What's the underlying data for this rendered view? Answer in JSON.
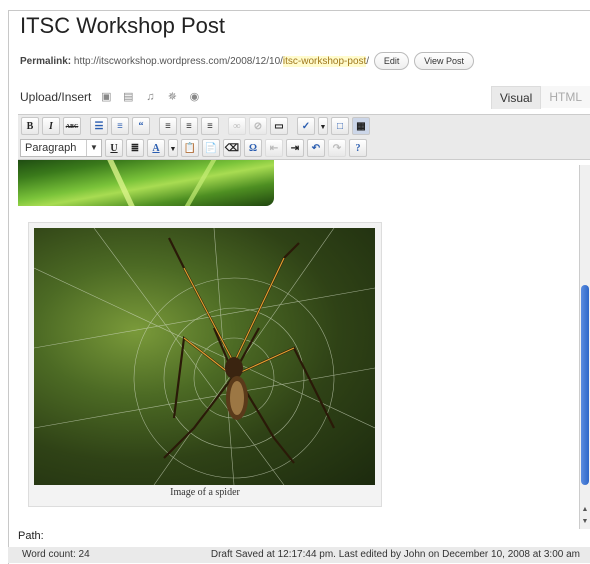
{
  "post": {
    "title": "ITSC Workshop Post",
    "permalink_label": "Permalink:",
    "permalink_base": "http://itscworkshop.wordpress.com/2008/12/10/",
    "permalink_slug": "itsc-workshop-post",
    "permalink_trailing": "/",
    "edit_label": "Edit",
    "view_label": "View Post"
  },
  "upload": {
    "label": "Upload/Insert"
  },
  "tabs": {
    "visual": "Visual",
    "html": "HTML"
  },
  "toolbar": {
    "format_select": "Paragraph"
  },
  "content": {
    "caption": "Image of a spider"
  },
  "footer": {
    "path_label": "Path:",
    "word_count": "Word count: 24",
    "saved": "Draft Saved at 12:17:44 pm. Last edited by John on December 10, 2008 at 3:00 am"
  },
  "colors": {
    "toolbar_bg": "#eaeaea",
    "slug_highlight": "#fffbcc",
    "scroll_thumb": "#2e67c8"
  }
}
